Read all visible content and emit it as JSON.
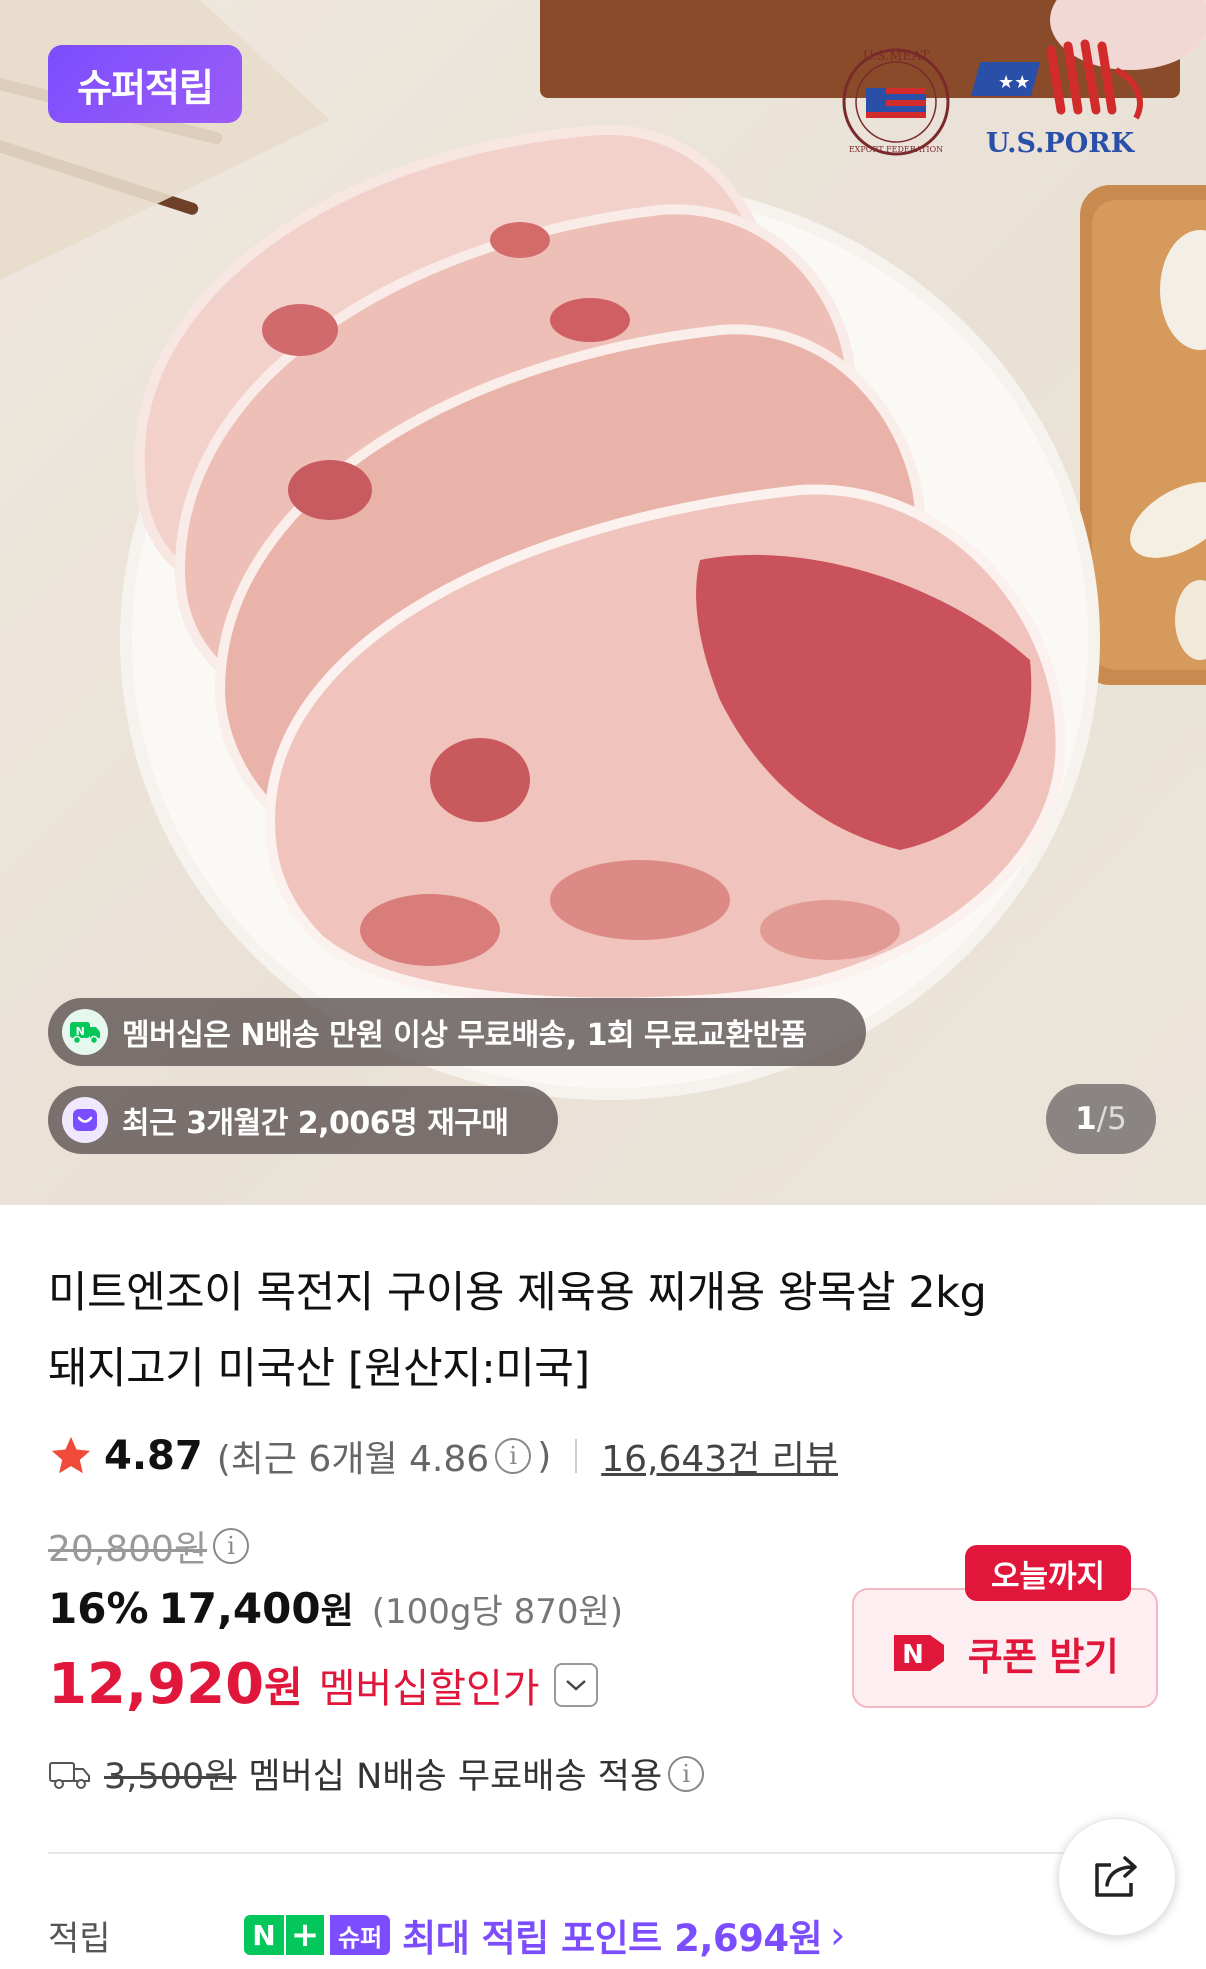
{
  "hero": {
    "super_badge": "슈퍼적립",
    "brand": {
      "meat_seal_top": "U.S.MEAT",
      "meat_seal_bottom": "EXPORT FEDERATION",
      "pork_logo": "U.S.PORK"
    },
    "delivery_pill": {
      "icon": "delivery-icon",
      "text": "멤버십은 N배송 만원 이상 무료배송, 1회 무료교환반품"
    },
    "repurchase_pill": {
      "icon": "repurchase-icon",
      "text": "최근 3개월간 2,006명 재구매"
    },
    "image_counter": {
      "current": "1",
      "separator": "/",
      "total": "5"
    }
  },
  "product": {
    "title_line1": "미트엔조이 목전지 구이용 제육용 찌개용 왕목살 2kg",
    "title_line2": "돼지고기 미국산 [원산지:미국]",
    "rating": {
      "score": "4.87",
      "recent_prefix": "(최근 6개월 4.86",
      "recent_suffix": ")",
      "reviews": "16,643건 리뷰"
    },
    "price": {
      "original": "20,800원",
      "discount_pct": "16%",
      "sale_price": "17,400",
      "won": "원",
      "unit_price": "(100g당 870원)",
      "member_price": "12,920",
      "member_won": "원",
      "member_label": "멤버십할인가"
    },
    "shipping": {
      "original_fee": "3,500원",
      "text": "멤버십 N배송 무료배송 적용"
    },
    "coupon": {
      "tag": "오늘까지",
      "label": "쿠폰 받기"
    },
    "points": {
      "label": "적립",
      "n_badge": "N",
      "plus_badge": "+",
      "super_badge": "슈퍼",
      "text": "최대 적립 포인트 2,694원",
      "arrow": "›"
    }
  },
  "colors": {
    "accent_red": "#e0173a",
    "super_purple": "#7c4dff",
    "naver_green": "#03c75a"
  }
}
